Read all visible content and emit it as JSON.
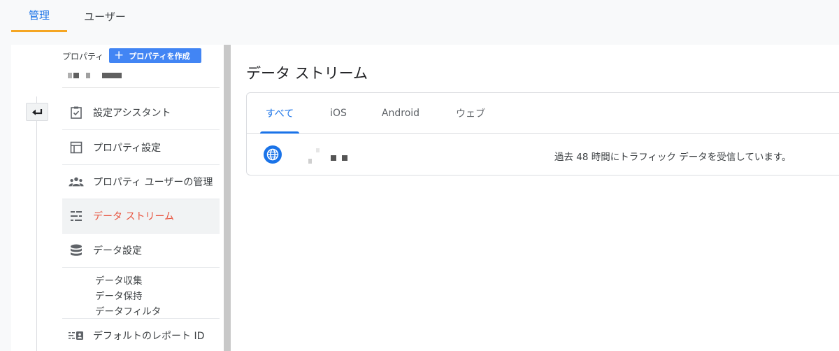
{
  "top_tabs": [
    {
      "label": "管理",
      "active": true
    },
    {
      "label": "ユーザー",
      "active": false
    }
  ],
  "property": {
    "label": "プロパティ",
    "create_button": "プロパティを作成"
  },
  "nav": {
    "items": [
      {
        "label": "設定アシスタント",
        "icon": "clipboard-check-icon"
      },
      {
        "label": "プロパティ設定",
        "icon": "layout-icon"
      },
      {
        "label": "プロパティ ユーザーの管理",
        "icon": "people-icon"
      },
      {
        "label": "データ ストリーム",
        "icon": "data-stream-icon",
        "active": true
      },
      {
        "label": "データ設定",
        "icon": "database-icon"
      },
      {
        "label": "デフォルトのレポート ID",
        "icon": "report-id-icon"
      }
    ],
    "sub_items": [
      "データ収集",
      "データ保持",
      "データフィルタ"
    ]
  },
  "page": {
    "title": "データ ストリーム"
  },
  "stream_tabs": [
    {
      "label": "すべて",
      "active": true
    },
    {
      "label": "iOS",
      "active": false
    },
    {
      "label": "Android",
      "active": false
    },
    {
      "label": "ウェブ",
      "active": false
    }
  ],
  "streams": [
    {
      "icon": "globe-icon",
      "status": "過去 48 時間にトラフィック データを受信しています。"
    }
  ],
  "colors": {
    "accent": "#1a73e8",
    "active_nav": "#e8543f",
    "tab_underline": "#f5a623",
    "create_button": "#4285f4"
  }
}
